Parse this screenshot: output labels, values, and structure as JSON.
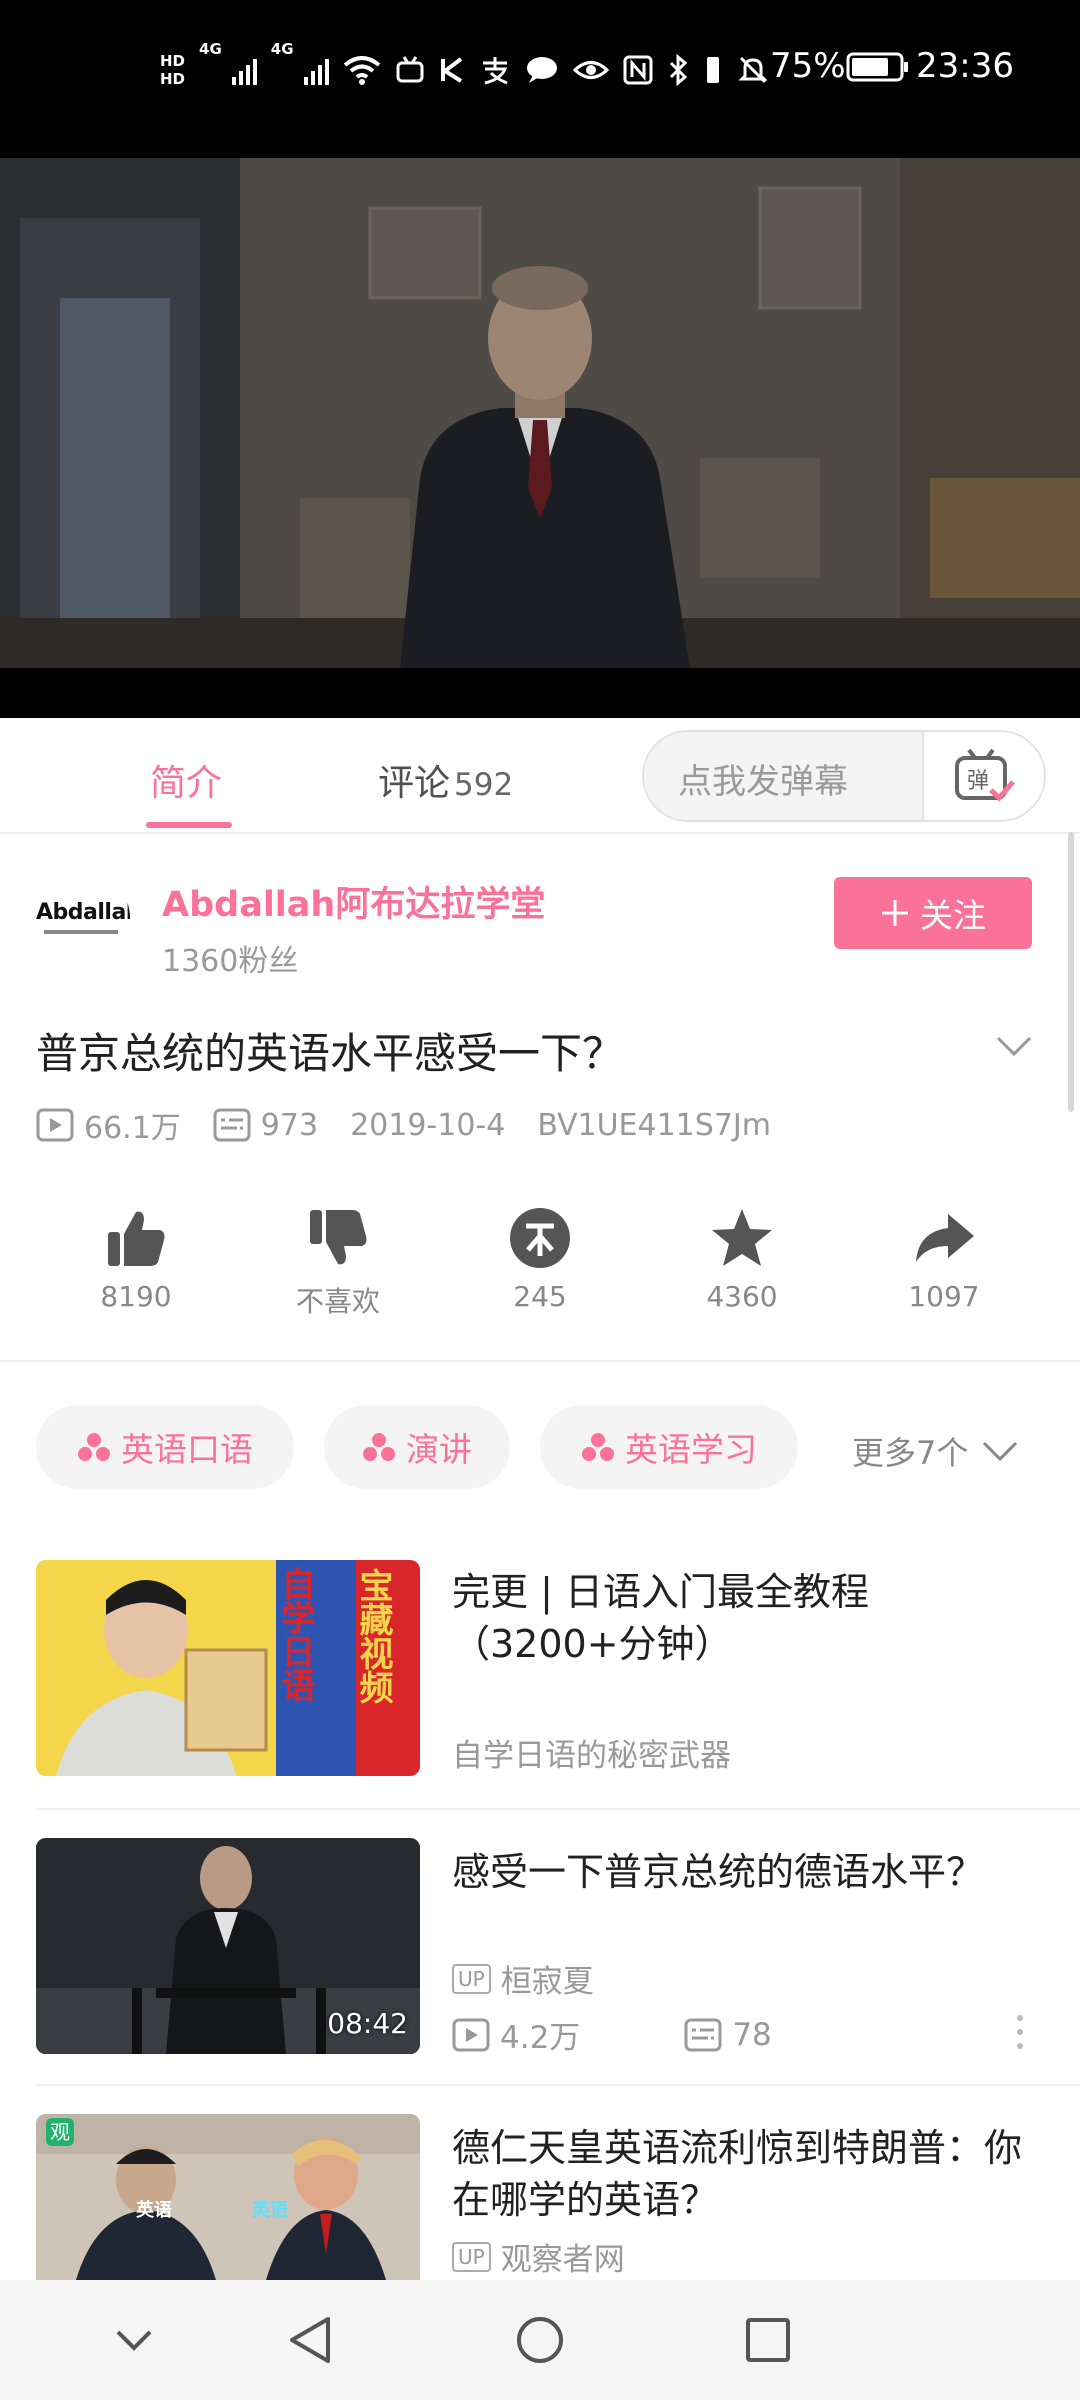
{
  "status_bar": {
    "hd1": "HD",
    "hd2": "HD",
    "network1": "4G",
    "network2": "4G",
    "battery": "75%",
    "time": "23:36"
  },
  "tabs": {
    "intro": "简介",
    "comments": "评论",
    "comments_count": "592",
    "danmaku_placeholder": "点我发弹幕"
  },
  "uploader": {
    "avatar_text": "Abdallah",
    "name": "Abdallah阿布达拉学堂",
    "fans": "1360粉丝",
    "follow_label": "关注"
  },
  "video": {
    "title": "普京总统的英语水平感受一下？",
    "views": "66.1万",
    "danmaku_count": "973",
    "date": "2019-10-4",
    "bvid": "BV1UE411S7Jm"
  },
  "actions": {
    "like": "8190",
    "dislike": "不喜欢",
    "coin": "245",
    "favorite": "4360",
    "share": "1097"
  },
  "tags": {
    "items": [
      "英语口语",
      "演讲",
      "英语学习"
    ],
    "more": "更多7个"
  },
  "related": [
    {
      "title": "完更 | 日语入门最全教程（3200+分钟）",
      "subtitle": "自学日语的秘密武器",
      "thumb_text_a": "宝藏视频",
      "thumb_text_b": "自学日语"
    },
    {
      "title": "感受一下普京总统的德语水平？",
      "up_badge": "UP",
      "uploader": "桓寂夏",
      "views": "4.2万",
      "danmaku": "78",
      "duration": "08:42"
    },
    {
      "title": "德仁天皇英语流利惊到特朗普：你在哪学的英语？",
      "up_badge": "UP",
      "uploader": "观察者网",
      "thumb_label_a": "英语",
      "thumb_label_b": "英语",
      "thumb_corner": "观"
    }
  ],
  "colors": {
    "accent": "#fb7299",
    "text_primary": "#212121",
    "text_secondary": "#999999"
  }
}
